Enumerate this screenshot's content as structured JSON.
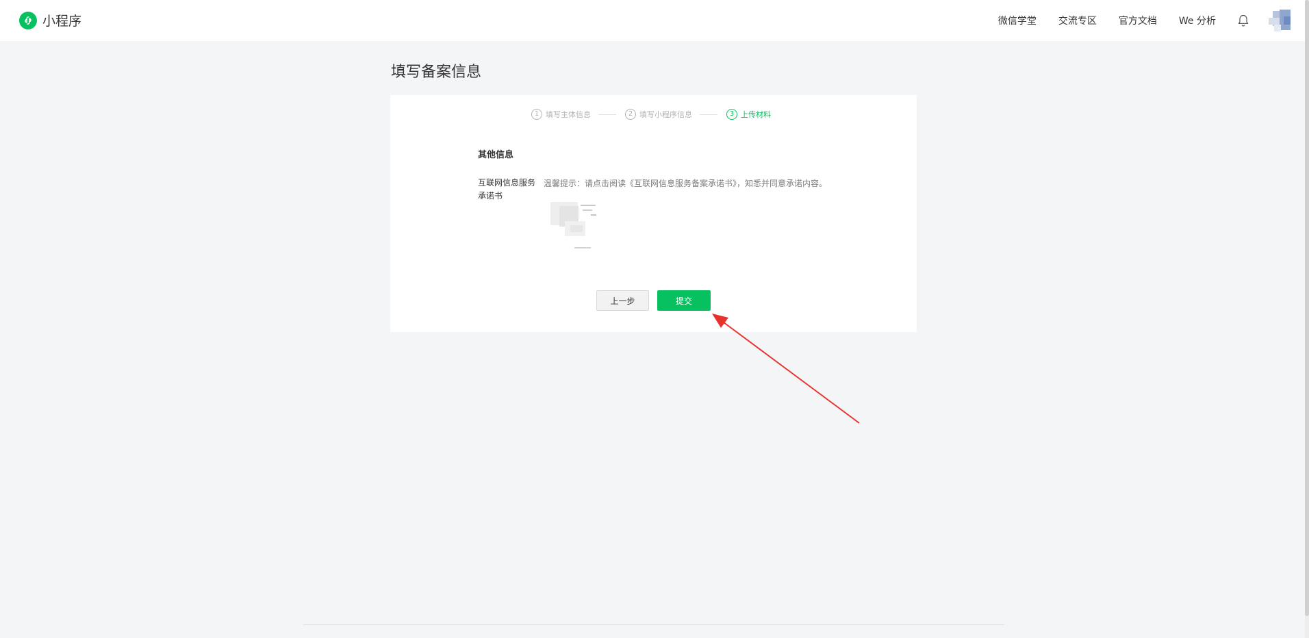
{
  "app": {
    "title": "小程序",
    "brand_color": "#07c160"
  },
  "nav": {
    "items": [
      "微信学堂",
      "交流专区",
      "官方文档",
      "We 分析"
    ],
    "bell_icon": "bell-icon",
    "avatar_icon": "avatar"
  },
  "page": {
    "title": "填写备案信息"
  },
  "steps": [
    {
      "num": "1",
      "label": "填写主体信息",
      "state": "done"
    },
    {
      "num": "2",
      "label": "填写小程序信息",
      "state": "done"
    },
    {
      "num": "3",
      "label": "上传材料",
      "state": "active"
    }
  ],
  "form": {
    "section_title": "其他信息",
    "field_label": "互联网信息服务承诺书",
    "hint": "温馨提示：请点击阅读《互联网信息服务备案承诺书》，知悉并同意承诺内容。"
  },
  "buttons": {
    "prev": "上一步",
    "submit": "提交"
  },
  "colors": {
    "annotation_arrow": "#e8322e",
    "page_bg": "#f4f5f7"
  }
}
